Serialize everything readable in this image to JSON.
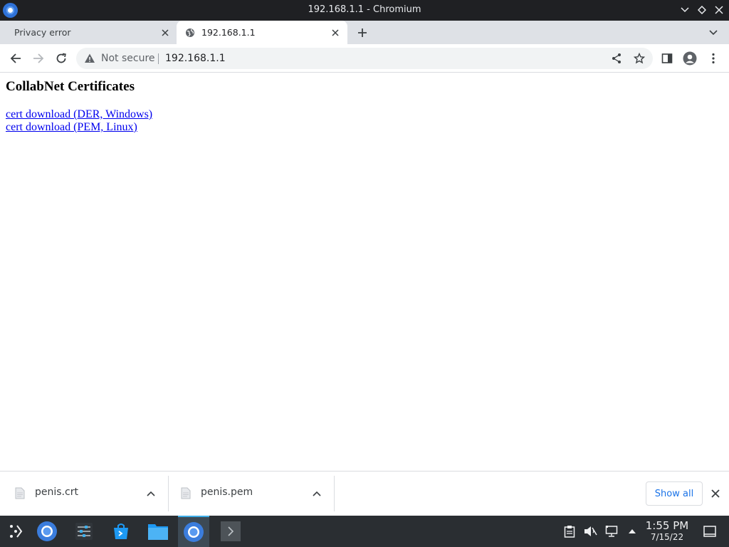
{
  "window": {
    "title": "192.168.1.1 - Chromium"
  },
  "tabs": [
    {
      "label": "Privacy error",
      "active": false
    },
    {
      "label": "192.168.1.1",
      "active": true
    }
  ],
  "omnibox": {
    "security_label": "Not secure",
    "url": "192.168.1.1"
  },
  "page": {
    "heading": "CollabNet Certificates",
    "links": [
      "cert download (DER, Windows)",
      "cert download (PEM, Linux)"
    ]
  },
  "downloads": {
    "items": [
      {
        "name": "penis.crt"
      },
      {
        "name": "penis.pem"
      }
    ],
    "show_all_label": "Show all"
  },
  "taskbar": {
    "time": "1:55 PM",
    "date": "7/15/22"
  },
  "colors": {
    "titlebar_bg": "#1f2023",
    "tabstrip_bg": "#dee1e6",
    "link": "#0000ee",
    "taskbar_bg": "#2a2e32",
    "accent": "#1a73e8"
  }
}
